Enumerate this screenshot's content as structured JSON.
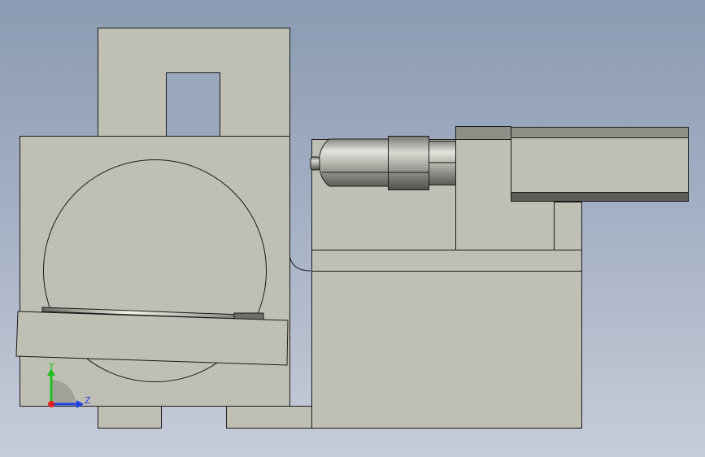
{
  "colors": {
    "viewport_top": "#8a9bb3",
    "viewport_bottom": "#c7ccd9",
    "part_face": "#c0bfb4",
    "part_edge": "#1a1a1a",
    "part_shadow": "#6e6f69",
    "axis_x": "#e02020",
    "axis_y": "#20c020",
    "axis_z": "#2040e0"
  },
  "triad": {
    "y_label": "Y",
    "z_label": "Z"
  }
}
